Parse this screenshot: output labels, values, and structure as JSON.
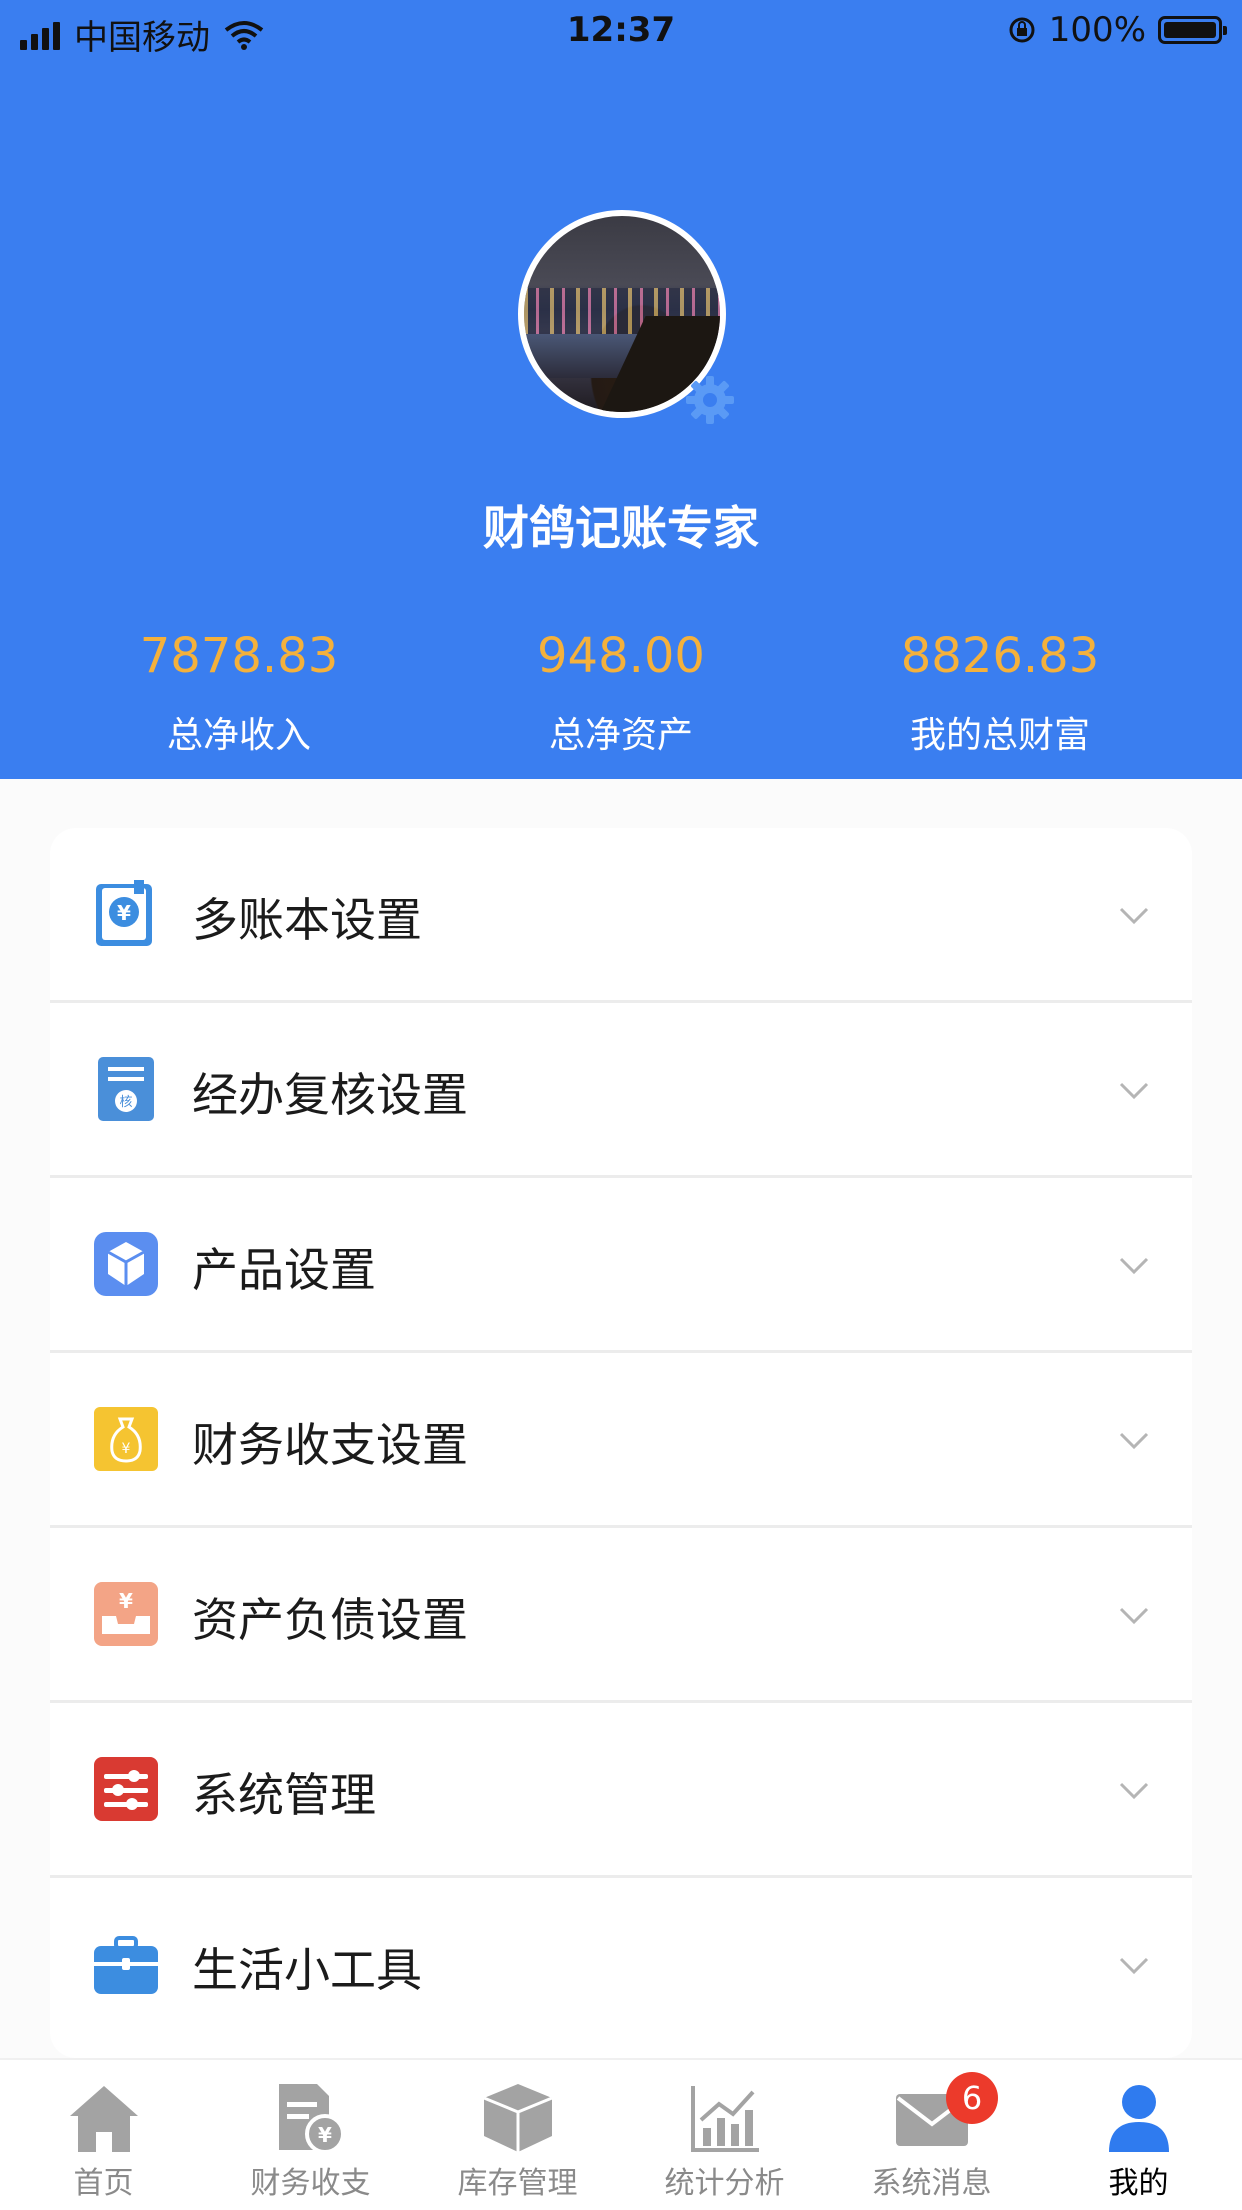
{
  "status_bar": {
    "carrier": "中国移动",
    "time": "12:37",
    "battery": "100%"
  },
  "profile": {
    "name": "财鸽记账专家"
  },
  "stats": [
    {
      "value": "7878.83",
      "label": "总净收入"
    },
    {
      "value": "948.00",
      "label": "总净资产"
    },
    {
      "value": "8826.83",
      "label": "我的总财富"
    }
  ],
  "menu": [
    {
      "label": "多账本设置",
      "icon": "ledger-yen-icon"
    },
    {
      "label": "经办复核设置",
      "icon": "review-document-icon"
    },
    {
      "label": "产品设置",
      "icon": "product-box-icon"
    },
    {
      "label": "财务收支设置",
      "icon": "money-bag-icon"
    },
    {
      "label": "资产负债设置",
      "icon": "asset-tray-icon"
    },
    {
      "label": "系统管理",
      "icon": "sliders-icon"
    },
    {
      "label": "生活小工具",
      "icon": "toolbox-icon"
    }
  ],
  "tabs": [
    {
      "label": "首页",
      "icon": "home-icon"
    },
    {
      "label": "财务收支",
      "icon": "finance-document-icon"
    },
    {
      "label": "库存管理",
      "icon": "inventory-box-icon"
    },
    {
      "label": "统计分析",
      "icon": "chart-icon"
    },
    {
      "label": "系统消息",
      "icon": "mail-icon",
      "badge": "6"
    },
    {
      "label": "我的",
      "icon": "user-icon",
      "active": true
    }
  ],
  "colors": {
    "primary": "#3a7ef0",
    "stat_value": "#f4b13c",
    "badge": "#ec3a2b"
  }
}
